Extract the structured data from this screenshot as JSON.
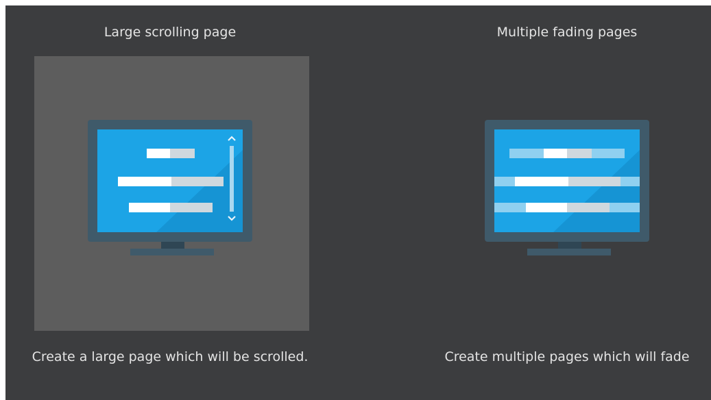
{
  "options": [
    {
      "title": "Large scrolling page",
      "description": "Create a large page which will be scrolled.",
      "icon": "monitor-scrolling-icon",
      "selected": true
    },
    {
      "title": "Multiple fading pages",
      "description": "Create multiple pages which will fade",
      "icon": "monitor-fading-icon",
      "selected": false
    }
  ],
  "colors": {
    "panel_bg": "#3c3d3f",
    "selected_tile": "#5d5d5d",
    "monitor_frame": "#3f5a6a",
    "screen_blue": "#1ca4e6",
    "text": "#e4e4e4"
  }
}
